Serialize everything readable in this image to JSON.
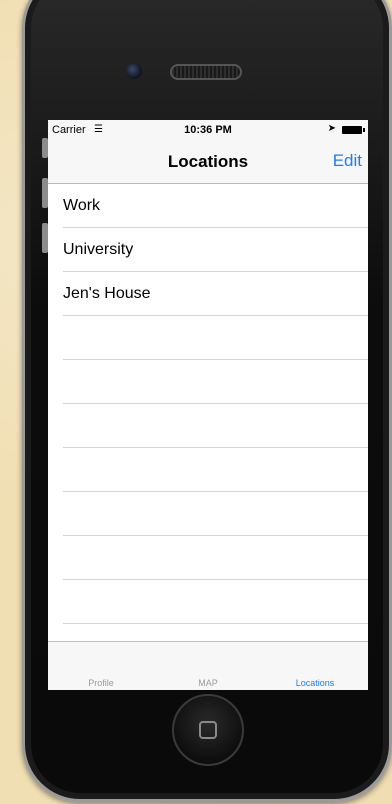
{
  "status": {
    "carrier": "Carrier",
    "wifi_icon": "wifi-icon",
    "time": "10:36 PM",
    "location_icon": "location-arrow-icon",
    "battery_icon": "battery-icon"
  },
  "nav": {
    "title": "Locations",
    "edit_label": "Edit"
  },
  "locations": [
    "Work",
    "University",
    "Jen's House"
  ],
  "tabs": [
    {
      "label": "Profile"
    },
    {
      "label": "MAP"
    },
    {
      "label": "Locations"
    }
  ],
  "colors": {
    "accent": "#1e7cf5",
    "bar_background": "#f7f7f7",
    "separator": "#d4d4d8",
    "inactive_tab": "#9a9a9a"
  }
}
